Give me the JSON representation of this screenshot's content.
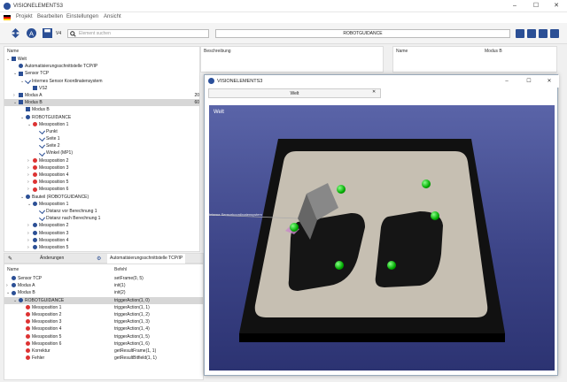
{
  "window": {
    "title": "VISIONELEMENTS3"
  },
  "menu": {
    "items": [
      "Projekt",
      "Bearbeiten",
      "Einstellungen",
      "Ansicht"
    ]
  },
  "toolbar": {
    "version": "V4",
    "search_placeholder": "Element suchen",
    "breadcrumb": "ROBOTGUIDANCE"
  },
  "tree": {
    "header_name": "Name",
    "rows": [
      {
        "label": "Welt",
        "indent": 0,
        "arrow": "v",
        "icon": "sq"
      },
      {
        "label": "Automatisierungsschnittstelle TCP/IP",
        "indent": 1,
        "arrow": "",
        "icon": "blue"
      },
      {
        "label": "Sensor TCP",
        "indent": 1,
        "arrow": "v",
        "icon": "sq"
      },
      {
        "label": "Internes Sensor Koordinatensystem",
        "indent": 2,
        "arrow": "v",
        "icon": "ck"
      },
      {
        "label": "VS2",
        "indent": 3,
        "arrow": "",
        "icon": "sq"
      },
      {
        "label": "Modus A",
        "indent": 1,
        "arrow": ">",
        "icon": "sq",
        "value": "20"
      },
      {
        "label": "Modus B",
        "indent": 1,
        "arrow": "v",
        "icon": "sq",
        "value": "60",
        "selected": true
      },
      {
        "label": "Modus B",
        "indent": 2,
        "arrow": "",
        "icon": "sq"
      },
      {
        "label": "ROBOTGUIDANCE",
        "indent": 2,
        "arrow": "v",
        "icon": "blue"
      },
      {
        "label": "Messposition 1",
        "indent": 3,
        "arrow": "v",
        "icon": "red"
      },
      {
        "label": "Punkt",
        "indent": 4,
        "arrow": "",
        "icon": "ck"
      },
      {
        "label": "Seite 1",
        "indent": 4,
        "arrow": "",
        "icon": "ck"
      },
      {
        "label": "Seite 2",
        "indent": 4,
        "arrow": "",
        "icon": "ck"
      },
      {
        "label": "Winkel (MP1)",
        "indent": 4,
        "arrow": "",
        "icon": "ck"
      },
      {
        "label": "Messposition 2",
        "indent": 3,
        "arrow": ">",
        "icon": "red"
      },
      {
        "label": "Messposition 3",
        "indent": 3,
        "arrow": ">",
        "icon": "red"
      },
      {
        "label": "Messposition 4",
        "indent": 3,
        "arrow": ">",
        "icon": "red"
      },
      {
        "label": "Messposition 5",
        "indent": 3,
        "arrow": ">",
        "icon": "red"
      },
      {
        "label": "Messposition 6",
        "indent": 3,
        "arrow": ">",
        "icon": "red"
      },
      {
        "label": "Bauteil (ROBOTGUIDANCE)",
        "indent": 2,
        "arrow": "v",
        "icon": "blue"
      },
      {
        "label": "Messposition 1",
        "indent": 3,
        "arrow": "v",
        "icon": "blue"
      },
      {
        "label": "Distanz vor Berechnung 1",
        "indent": 4,
        "arrow": "",
        "icon": "ck"
      },
      {
        "label": "Distanz nach Berechnung 1",
        "indent": 4,
        "arrow": "",
        "icon": "ck"
      },
      {
        "label": "Messposition 2",
        "indent": 3,
        "arrow": ">",
        "icon": "blue"
      },
      {
        "label": "Messposition 3",
        "indent": 3,
        "arrow": ">",
        "icon": "blue"
      },
      {
        "label": "Messposition 4",
        "indent": 3,
        "arrow": ">",
        "icon": "blue"
      },
      {
        "label": "Messposition 5",
        "indent": 3,
        "arrow": ">",
        "icon": "blue"
      }
    ]
  },
  "description_panel": {
    "header": "Beschreibung"
  },
  "name_panel": {
    "header_name": "Name",
    "header_value": "Modus B"
  },
  "bottom_tabs": {
    "changes": "Änderungen",
    "interface": "Automatisierungsschnittstelle TCP/IP"
  },
  "bottom_table": {
    "col_name": "Name",
    "col_cmd": "Befehl",
    "rows": [
      {
        "name": "Sensor TCP",
        "cmd": "setFrame(0, 5)",
        "indent": 0,
        "arrow": ""
      },
      {
        "name": "Modus A",
        "cmd": "init(1)",
        "indent": 0,
        "arrow": ">"
      },
      {
        "name": "Modus B",
        "cmd": "init(2)",
        "indent": 0,
        "arrow": "v"
      },
      {
        "name": "ROBOTGUIDANCE",
        "cmd": "triggerAction(1, 0)",
        "indent": 1,
        "arrow": "v",
        "selected": true
      },
      {
        "name": "Messposition 1",
        "cmd": "triggerAction(1, 1)",
        "indent": 2,
        "arrow": ""
      },
      {
        "name": "Messposition 2",
        "cmd": "triggerAction(1, 2)",
        "indent": 2,
        "arrow": ""
      },
      {
        "name": "Messposition 3",
        "cmd": "triggerAction(1, 3)",
        "indent": 2,
        "arrow": ""
      },
      {
        "name": "Messposition 4",
        "cmd": "triggerAction(1, 4)",
        "indent": 2,
        "arrow": ""
      },
      {
        "name": "Messposition 5",
        "cmd": "triggerAction(1, 5)",
        "indent": 2,
        "arrow": ""
      },
      {
        "name": "Messposition 6",
        "cmd": "triggerAction(1, 6)",
        "indent": 2,
        "arrow": ""
      },
      {
        "name": "Korrektur",
        "cmd": "getResultFrame(1, 1)",
        "indent": 2,
        "arrow": ""
      },
      {
        "name": "Fehler",
        "cmd": "getResultBitfield(1, 1)",
        "indent": 2,
        "arrow": ""
      }
    ]
  },
  "popup": {
    "title": "VISIONELEMENTS3",
    "tab": "Welt",
    "viewport_label": "Welt",
    "overlay_label": "Interne Sensorkoordinatensystem"
  }
}
